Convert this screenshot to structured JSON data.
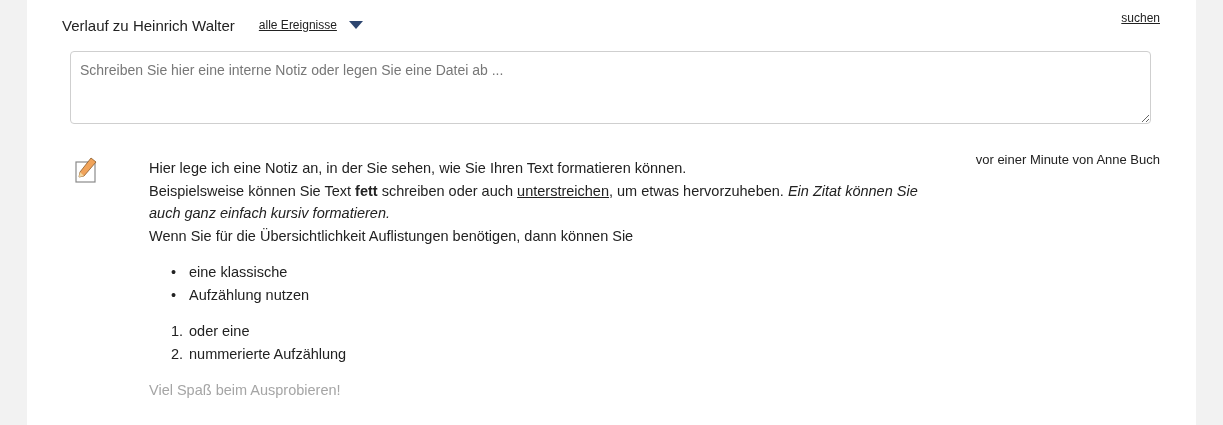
{
  "header": {
    "title": "Verlauf zu Heinrich Walter",
    "filter_link": "alle Ereignisse",
    "search_link": "suchen"
  },
  "note_input": {
    "placeholder": "Schreiben Sie hier eine interne Notiz oder legen Sie eine Datei ab ..."
  },
  "entries": [
    {
      "meta": "vor einer Minute von Anne Buch",
      "blocks": [
        {
          "kind": "paragraph",
          "segments": [
            {
              "kind": "plain",
              "text": "Hier lege ich eine Notiz an, in der Sie sehen, wie Sie Ihren Text formatieren können."
            }
          ]
        },
        {
          "kind": "paragraph",
          "segments": [
            {
              "kind": "plain",
              "text": "Beispielsweise können Sie Text "
            },
            {
              "kind": "bold",
              "text": "fett"
            },
            {
              "kind": "plain",
              "text": " schreiben oder auch "
            },
            {
              "kind": "underline",
              "text": "unterstreichen"
            },
            {
              "kind": "plain",
              "text": ", um etwas hervorzuheben. "
            },
            {
              "kind": "italic",
              "text": "Ein Zitat können Sie auch ganz einfach kursiv formatieren."
            }
          ]
        },
        {
          "kind": "paragraph",
          "segments": [
            {
              "kind": "plain",
              "text": "Wenn Sie für die Übersichtlichkeit Auflistungen benötigen, dann können Sie"
            }
          ]
        },
        {
          "kind": "list",
          "items": [
            {
              "marker": "•",
              "text": "eine klassische"
            },
            {
              "marker": "•",
              "text": "Aufzählung nutzen"
            }
          ]
        },
        {
          "kind": "list",
          "items": [
            {
              "marker": "1.",
              "text": "oder eine"
            },
            {
              "marker": "2.",
              "text": "nummerierte Aufzählung"
            }
          ]
        },
        {
          "kind": "muted",
          "segments": [
            {
              "kind": "plain",
              "text": "Viel Spaß beim Ausprobieren!"
            }
          ]
        }
      ]
    }
  ]
}
